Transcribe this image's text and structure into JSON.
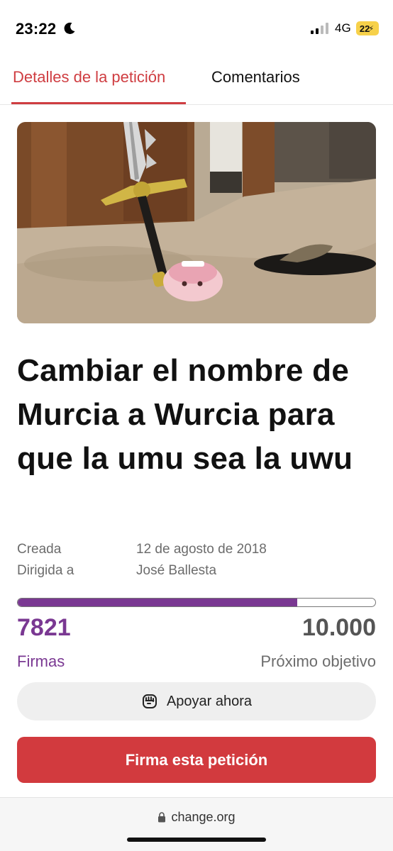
{
  "status_bar": {
    "time": "23:22",
    "network": "4G",
    "battery": "22"
  },
  "tabs": [
    {
      "label": "Detalles de la petición",
      "active": true
    },
    {
      "label": "Comentarios",
      "active": false
    }
  ],
  "petition": {
    "title": "Cambiar el nombre de Murcia a Wurcia para que la umu sea la uwu",
    "meta": [
      {
        "label": "Creada",
        "value": "12 de agosto de 2018"
      },
      {
        "label": "Dirigida a",
        "value": "José Ballesta"
      }
    ],
    "signatures": "7821",
    "signatures_label": "Firmas",
    "goal": "10.000",
    "goal_label": "Próximo objetivo",
    "progress_fraction": 0.7821
  },
  "buttons": {
    "support": "Apoyar ahora",
    "sign": "Firma esta petición"
  },
  "browser": {
    "url": "change.org"
  },
  "colors": {
    "accent_red": "#d23a3e",
    "tab_red": "#cf3d41",
    "purple": "#7a3892"
  },
  "icons": [
    "moon-icon",
    "signal-icon",
    "battery-icon",
    "fist-icon",
    "lock-icon"
  ]
}
